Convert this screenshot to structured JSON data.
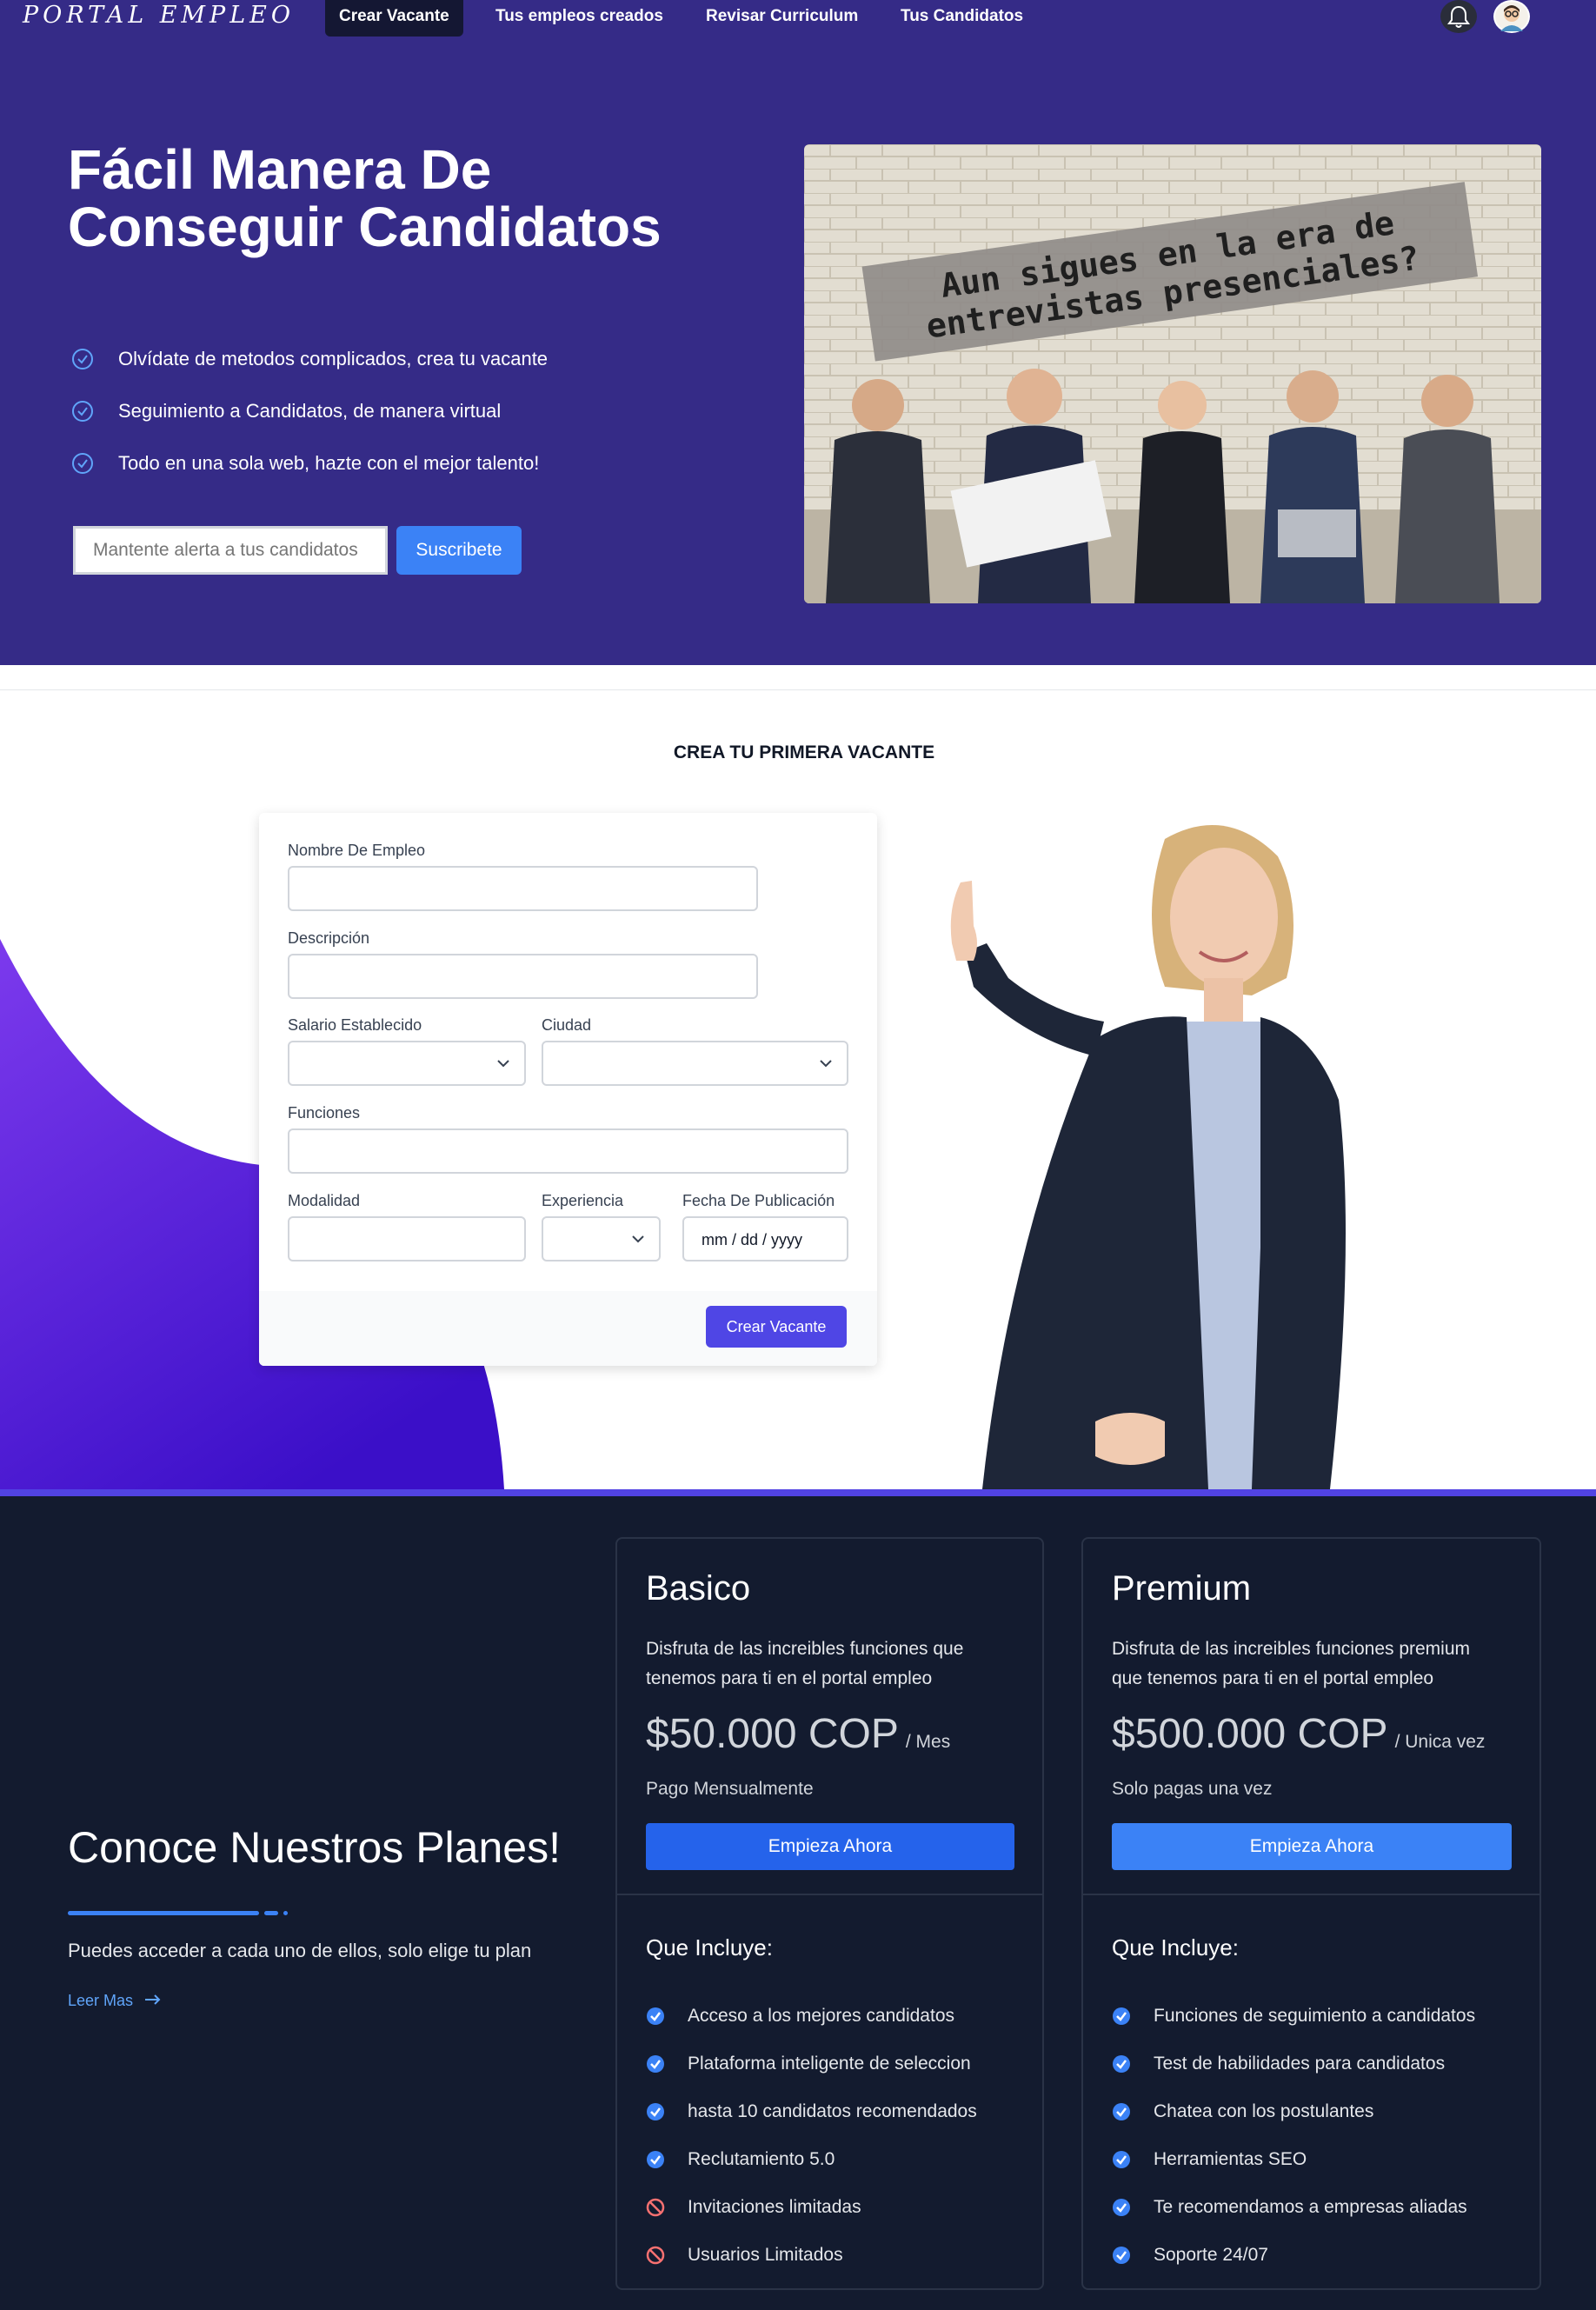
{
  "nav": {
    "brand": "PORTAL EMPLEO",
    "links": [
      "Crear Vacante",
      "Tus empleos creados",
      "Revisar Curriculum",
      "Tus Candidatos"
    ],
    "bell_icon": "bell-icon",
    "avatar_icon": "user-avatar"
  },
  "hero": {
    "title": "Fácil Manera De Conseguir Candidatos",
    "bullets": [
      "Olvídate de metodos complicados, crea tu vacante",
      "Seguimiento a Candidatos, de manera virtual",
      "Todo en una sola web, hazte con el mejor talento!"
    ],
    "subscribe_placeholder": "Mantente alerta a tus candidatos",
    "subscribe_button": "Suscribete",
    "image_text": [
      "Aun sigues en la era de",
      "entrevistas presenciales?"
    ]
  },
  "form": {
    "section_title": "CREA TU PRIMERA VACANTE",
    "labels": {
      "name": "Nombre De Empleo",
      "description": "Descripción",
      "salary": "Salario Establecido",
      "city": "Ciudad",
      "functions": "Funciones",
      "modality": "Modalidad",
      "experience": "Experiencia",
      "date": "Fecha De Publicación"
    },
    "date_placeholder": "mm / dd / yyyy",
    "submit": "Crear Vacante"
  },
  "plans": {
    "title": "Conoce Nuestros Planes!",
    "subtitle": "Puedes acceder a cada uno de ellos, solo elige tu plan",
    "read_more": "Leer Mas",
    "includes_label": "Que Incluye:",
    "basic": {
      "name": "Basico",
      "description": "Disfruta de las increibles funciones que tenemos para ti en el portal empleo",
      "price": "$50.000 COP",
      "period": "/ Mes",
      "note": "Pago Mensualmente",
      "button": "Empieza Ahora",
      "features": [
        {
          "text": "Acceso a los mejores candidatos",
          "included": true
        },
        {
          "text": "Plataforma inteligente de seleccion",
          "included": true
        },
        {
          "text": "hasta 10 candidatos recomendados",
          "included": true
        },
        {
          "text": "Reclutamiento 5.0",
          "included": true
        },
        {
          "text": "Invitaciones limitadas",
          "included": false
        },
        {
          "text": "Usuarios Limitados",
          "included": false
        }
      ]
    },
    "premium": {
      "name": "Premium",
      "description": "Disfruta de las increibles funciones premium que tenemos para ti en el portal empleo",
      "price": "$500.000 COP",
      "period": "/ Unica vez",
      "note": "Solo pagas una vez",
      "button": "Empieza Ahora",
      "features": [
        {
          "text": "Funciones de seguimiento a candidatos",
          "included": true
        },
        {
          "text": "Test de habilidades para candidatos",
          "included": true
        },
        {
          "text": "Chatea con los postulantes",
          "included": true
        },
        {
          "text": "Herramientas SEO",
          "included": true
        },
        {
          "text": "Te recomendamos a empresas aliadas",
          "included": true
        },
        {
          "text": "Soporte 24/07",
          "included": true
        }
      ]
    }
  },
  "colors": {
    "hero_bg": "#352b87",
    "accent_blue": "#3b82f6",
    "primary_button": "#4f46e5",
    "plans_bg": "#131b2f",
    "excluded_red": "#f87171"
  }
}
